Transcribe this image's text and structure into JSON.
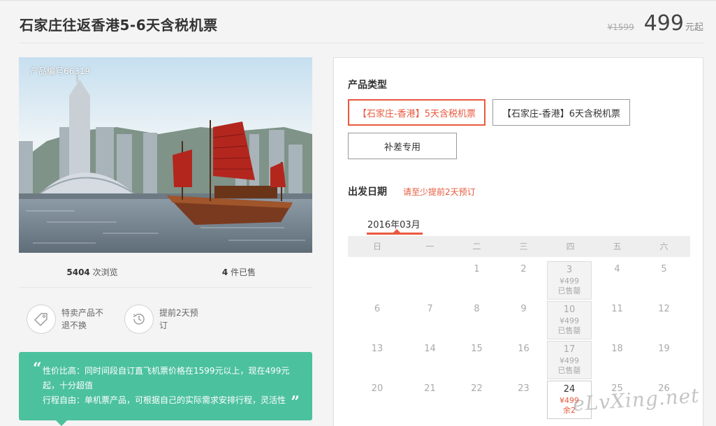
{
  "product": {
    "title": "石家庄往返香港5-6天含税机票",
    "original_price": "¥1599",
    "price": "499",
    "price_suffix": "元起",
    "product_no": "产品编号66319",
    "views_count": "5404",
    "views_label": " 次浏览",
    "sold_count": "4",
    "sold_label": " 件已售"
  },
  "features": [
    {
      "icon": "tag-icon",
      "text": "特卖产品不退不换"
    },
    {
      "icon": "clock-history-icon",
      "text": "提前2天预订"
    }
  ],
  "quote": {
    "open": "“",
    "close": "”",
    "line1": "性价比高：同时间段自订直飞机票价格在1599元以上，现在499元起，十分超值",
    "line2": "行程自由：单机票产品，可根据自己的实际需求安排行程，灵活性"
  },
  "booking": {
    "type_label": "产品类型",
    "options": [
      "【石家庄-香港】5天含税机票",
      "【石家庄-香港】6天含税机票",
      "补差专用"
    ],
    "date_label": "出发日期",
    "date_hint": "请至少提前2天预订",
    "month": "2016年03月",
    "weekdays": [
      "日",
      "一",
      "二",
      "三",
      "四",
      "五",
      "六"
    ],
    "weeks": [
      [
        {
          "d": ""
        },
        {
          "d": ""
        },
        {
          "d": "1"
        },
        {
          "d": "2"
        },
        {
          "d": "3",
          "price": "¥499",
          "status": "已售罄",
          "state": "sold"
        },
        {
          "d": "4"
        },
        {
          "d": "5"
        }
      ],
      [
        {
          "d": "6"
        },
        {
          "d": "7"
        },
        {
          "d": "8"
        },
        {
          "d": "9"
        },
        {
          "d": "10",
          "price": "¥499",
          "status": "已售罄",
          "state": "sold"
        },
        {
          "d": "11"
        },
        {
          "d": "12"
        }
      ],
      [
        {
          "d": "13"
        },
        {
          "d": "14"
        },
        {
          "d": "15"
        },
        {
          "d": "16"
        },
        {
          "d": "17",
          "price": "¥499",
          "status": "已售罄",
          "state": "sold"
        },
        {
          "d": "18"
        },
        {
          "d": "19"
        }
      ],
      [
        {
          "d": "20"
        },
        {
          "d": "21"
        },
        {
          "d": "22"
        },
        {
          "d": "23"
        },
        {
          "d": "24",
          "price": "¥499",
          "status": "余2",
          "state": "avail"
        },
        {
          "d": "25"
        },
        {
          "d": "26"
        }
      ]
    ]
  },
  "watermark": "eLvXing.net",
  "colors": {
    "accent": "#e8593e",
    "quote_bg": "#4cc19d"
  }
}
